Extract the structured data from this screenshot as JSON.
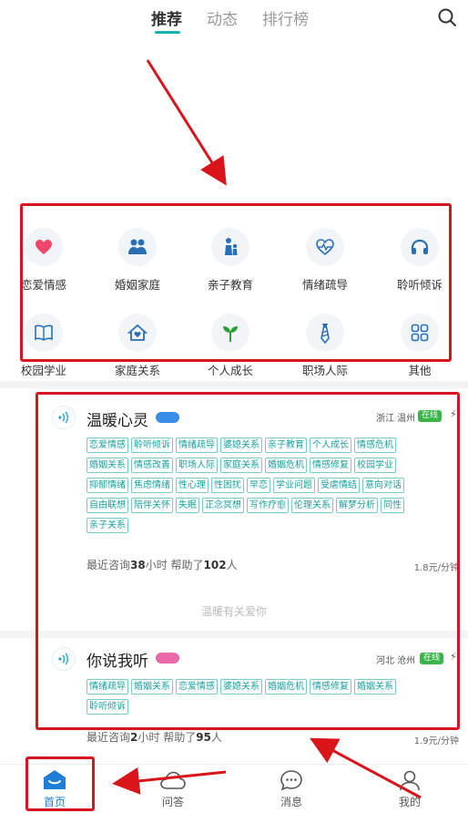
{
  "top_tabs": [
    {
      "label": "推荐",
      "active": true
    },
    {
      "label": "动态",
      "active": false
    },
    {
      "label": "排行榜",
      "active": false
    }
  ],
  "categories": [
    {
      "label": "恋爱情感",
      "icon": "heart-icon"
    },
    {
      "label": "婚姻家庭",
      "icon": "couple-icon"
    },
    {
      "label": "亲子教育",
      "icon": "parent-child-icon"
    },
    {
      "label": "情绪疏导",
      "icon": "heart-pulse-icon"
    },
    {
      "label": "聆听倾诉",
      "icon": "headphones-icon"
    },
    {
      "label": "校园学业",
      "icon": "book-icon"
    },
    {
      "label": "家庭关系",
      "icon": "home-heart-icon"
    },
    {
      "label": "个人成长",
      "icon": "sprout-icon"
    },
    {
      "label": "职场人际",
      "icon": "tie-icon"
    },
    {
      "label": "其他",
      "icon": "grid-icon"
    }
  ],
  "listeners": [
    {
      "name": "温暖心灵",
      "badge_color": "#3a8ee6",
      "location": "浙江 温州",
      "status": "在线",
      "tags": [
        "恋爱情感",
        "聆听倾诉",
        "情绪疏导",
        "婆媳关系",
        "亲子教育",
        "个人成长",
        "情感危机",
        "婚姻关系",
        "情感改善",
        "职场人际",
        "家庭关系",
        "婚姻危机",
        "情感修复",
        "校园学业",
        "抑郁情绪",
        "焦虑情绪",
        "性心理",
        "性困扰",
        "早恋",
        "学业问题",
        "受虐情结",
        "意向对话",
        "自由联想",
        "陪伴关怀",
        "失眠",
        "正念冥想",
        "写作疗愈",
        "伦理关系",
        "解梦分析",
        "同性",
        "亲子关系"
      ],
      "stat_prefix": "最近咨询",
      "hours": "38",
      "stat_mid": "小时 帮助了",
      "people": "102",
      "stat_suffix": "人",
      "price": "1.8元/分钟",
      "slogan": "温暖有关爱你"
    },
    {
      "name": "你说我听",
      "badge_color": "#e86aa8",
      "location": "河北 沧州",
      "status": "在线",
      "tags": [
        "情绪疏导",
        "婚姻关系",
        "恋爱情感",
        "婆媳关系",
        "婚姻危机",
        "情感修复",
        "婚姻关系",
        "聆听倾诉"
      ],
      "stat_prefix": "最近咨询",
      "hours": "2",
      "stat_mid": "小时 帮助了",
      "people": "95",
      "stat_suffix": "人",
      "price": "1.9元/分钟"
    }
  ],
  "bottom_nav": [
    {
      "label": "首页",
      "icon": "home-icon",
      "active": true
    },
    {
      "label": "问答",
      "icon": "cloud-icon",
      "active": false
    },
    {
      "label": "消息",
      "icon": "chat-icon",
      "active": false
    },
    {
      "label": "我的",
      "icon": "user-icon",
      "active": false
    }
  ],
  "colors": {
    "accent": "#16b2b2",
    "highlight_box": "#d9141b",
    "online": "#3bb54a",
    "active_nav": "#1e7fd6"
  }
}
